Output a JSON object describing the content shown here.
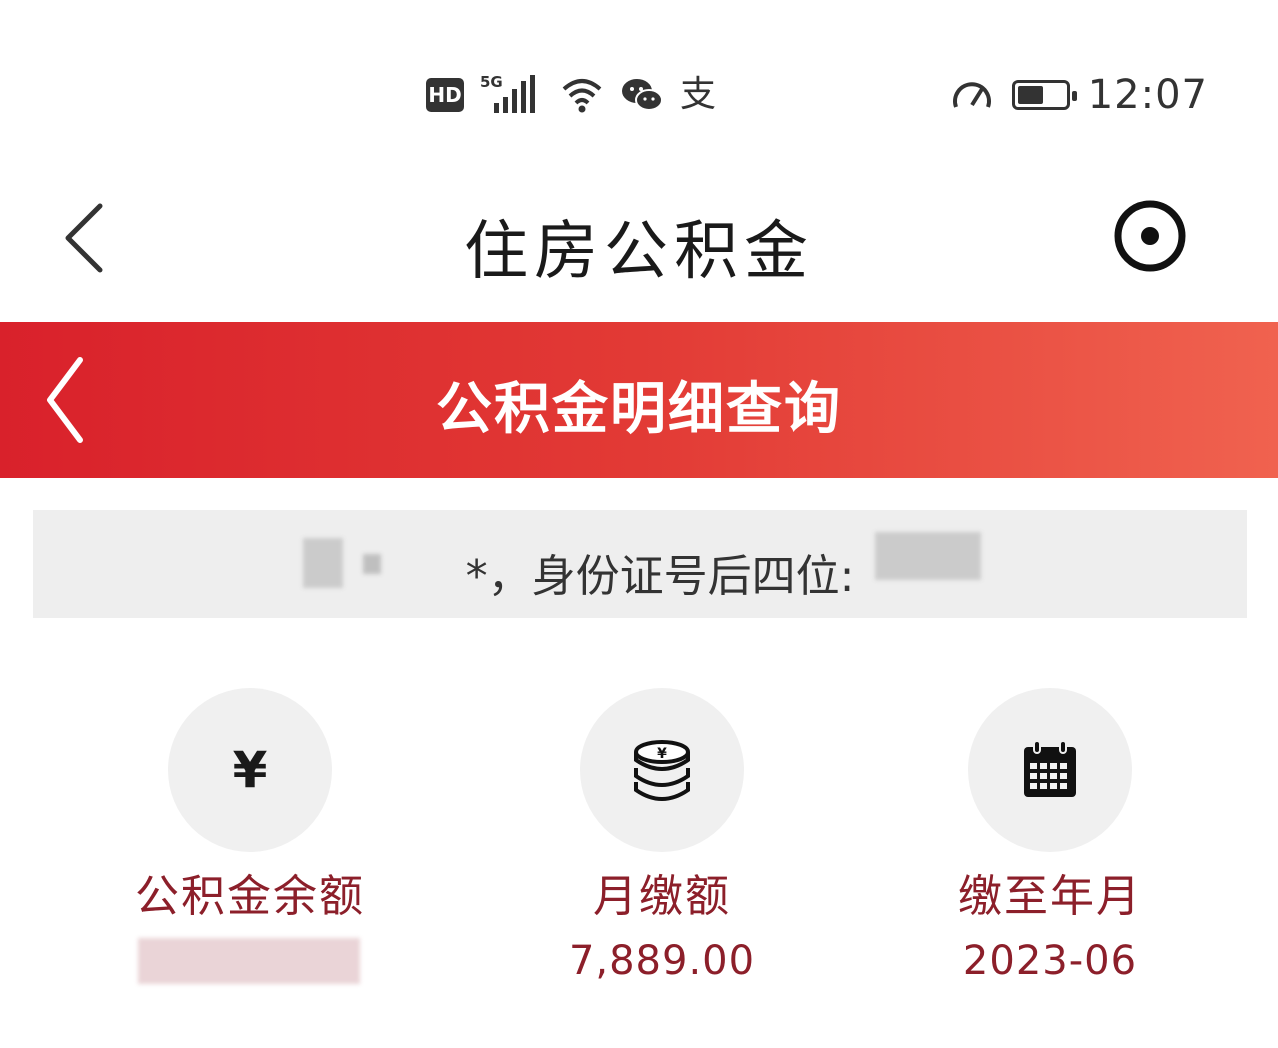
{
  "status_bar": {
    "hd_label": "HD",
    "network_label": "5G",
    "alipay_glyph": "支",
    "time": "12:07",
    "battery_level": 0.55
  },
  "app_nav": {
    "title": "住房公积金"
  },
  "sub_header": {
    "title": "公积金明细查询",
    "accent_color": "#e02a2f"
  },
  "info_banner": {
    "text": "*，身份证号后四位:"
  },
  "stats": [
    {
      "icon": "yen-icon",
      "icon_glyph": "¥",
      "label": "公积金余额",
      "value": ""
    },
    {
      "icon": "coin-stack-icon",
      "label": "月缴额",
      "value": "7,889.00"
    },
    {
      "icon": "calendar-icon",
      "label": "缴至年月",
      "value": "2023-06"
    }
  ]
}
